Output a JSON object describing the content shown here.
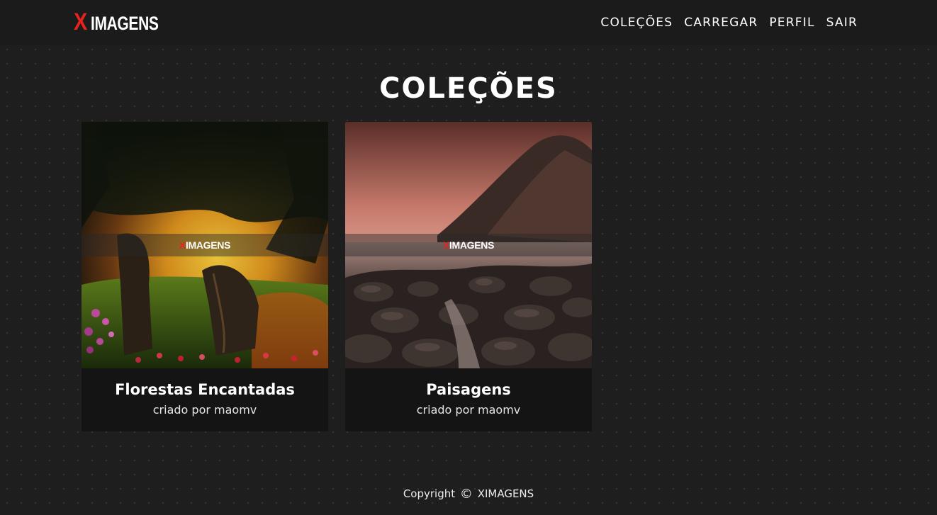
{
  "header": {
    "logo_x": "X",
    "logo_rest": "IMAGENS",
    "nav": [
      {
        "label": "COLEÇÕES"
      },
      {
        "label": "CARREGAR"
      },
      {
        "label": "PERFIL"
      },
      {
        "label": "SAIR"
      }
    ]
  },
  "main": {
    "title": "COLEÇÕES",
    "collections": [
      {
        "title": "Florestas Encantadas",
        "byline": "criado por maomv",
        "watermark_x": "X",
        "watermark_rest": "IMAGENS"
      },
      {
        "title": "Paisagens",
        "byline": "criado por maomv",
        "watermark_x": "X",
        "watermark_rest": "IMAGENS"
      }
    ]
  },
  "footer": {
    "prefix": "Copyright",
    "icon": "copyright-icon",
    "brand": "XIMAGENS"
  },
  "colors": {
    "accent": "#e8231d",
    "background": "#1e1e1e",
    "card": "#141414"
  }
}
